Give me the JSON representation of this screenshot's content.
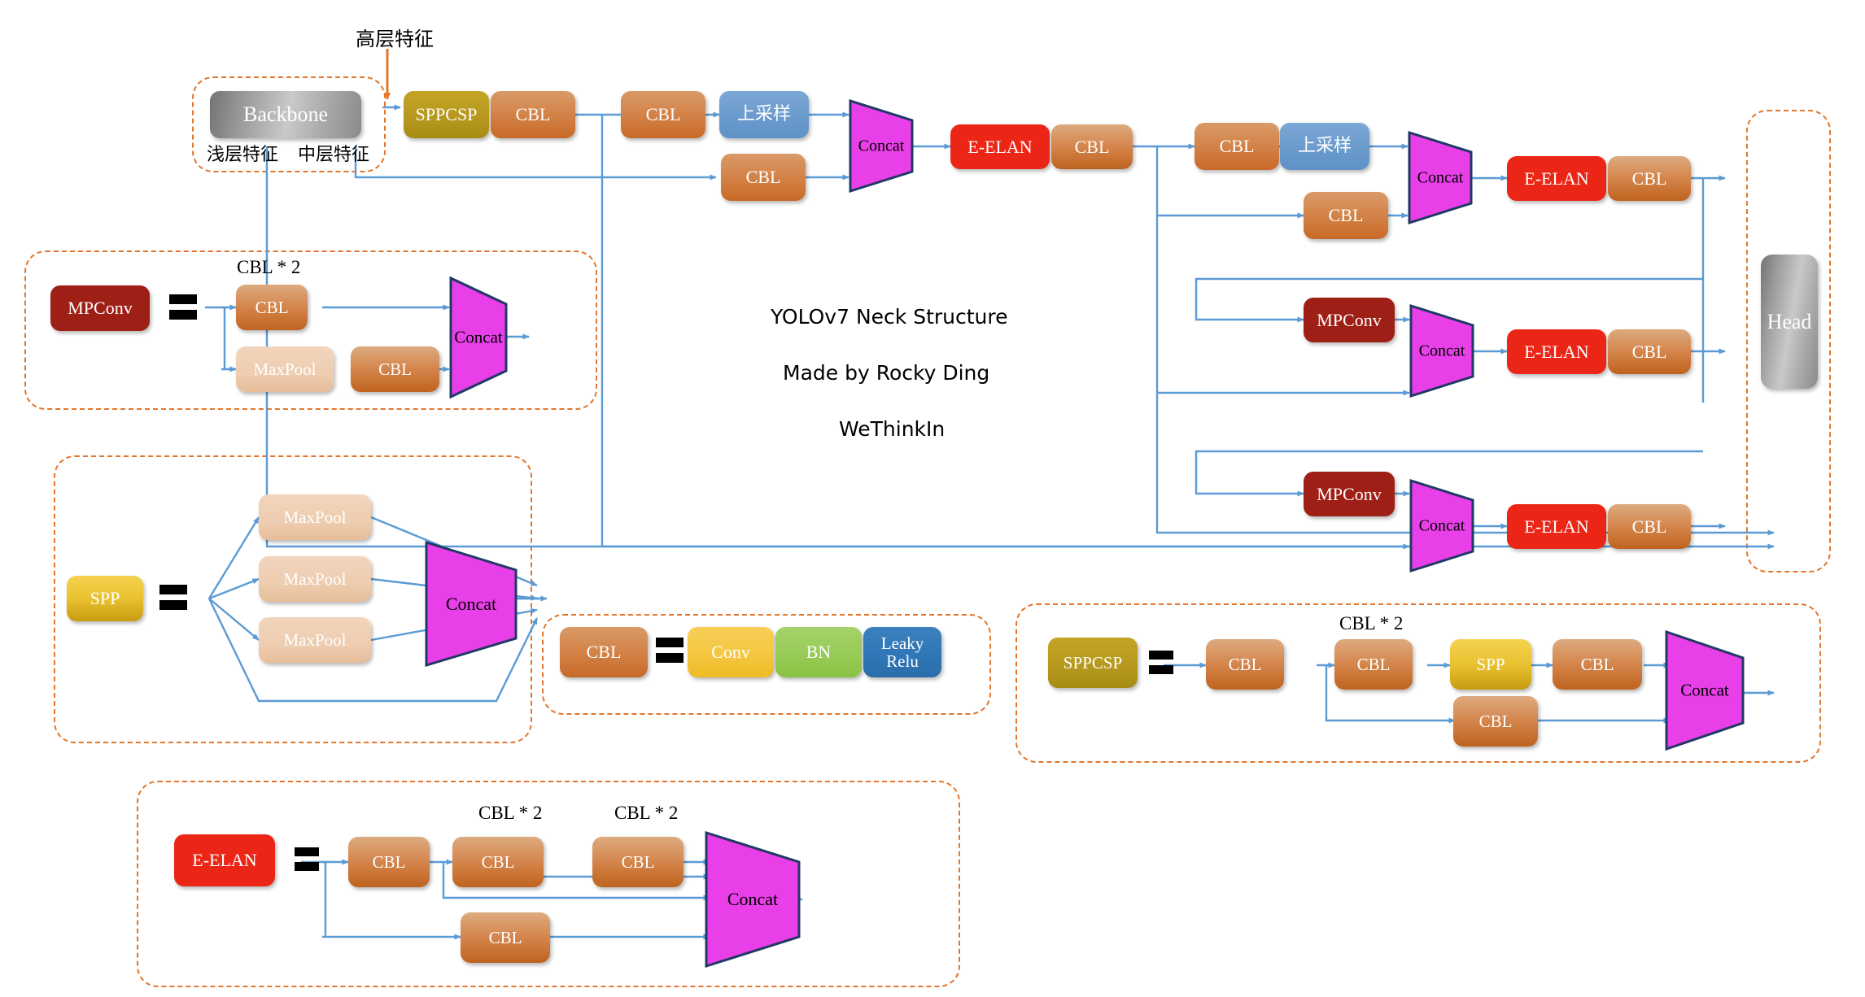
{
  "title": {
    "line1": "YOLOv7 Neck Structure",
    "line2": "Made by Rocky Ding",
    "line3": "WeThinkIn"
  },
  "colors": {
    "accent_dashed": "#e2762c",
    "wire": "#5b9bd5",
    "cbl": "#c86a28",
    "eelan": "#ec2616",
    "mpconv": "#9e1f15",
    "concat": "#e83fe8",
    "sppcsp": "#b89a1f",
    "spp": "#e9c231",
    "upsample": "#6b9bcd",
    "maxpool": "#eecdb0",
    "conv": "#f4c63f",
    "bn": "#96ca55",
    "leakyrelu": "#2f76b6",
    "gray_block": "#9a9a9a"
  },
  "backbone_group": {
    "block_label": "Backbone",
    "caption_shallow": "浅层特征",
    "caption_mid": "中层特征",
    "high_level_label": "高层特征"
  },
  "neck": {
    "row1": {
      "sppcsp": "SPPCSP",
      "cbl_a": "CBL",
      "cbl_b": "CBL",
      "upsample": "上采样",
      "cbl_skip": "CBL",
      "concat": "Concat",
      "eelan": "E-ELAN",
      "cbl_out": "CBL"
    },
    "row2": {
      "cbl_a": "CBL",
      "upsample": "上采样",
      "cbl_skip": "CBL",
      "concat": "Concat",
      "eelan": "E-ELAN",
      "cbl_out": "CBL"
    },
    "row3": {
      "mpconv": "MPConv",
      "concat": "Concat",
      "eelan": "E-ELAN",
      "cbl_out": "CBL"
    },
    "row4": {
      "mpconv": "MPConv",
      "concat": "Concat",
      "eelan": "E-ELAN",
      "cbl_out": "CBL"
    }
  },
  "head_group": {
    "block_label": "Head"
  },
  "legend_mpconv": {
    "lhs": "MPConv",
    "note": "CBL * 2",
    "cbl_top": "CBL",
    "maxpool": "MaxPool",
    "cbl_bottom": "CBL",
    "concat": "Concat"
  },
  "legend_spp": {
    "lhs": "SPP",
    "maxpool_1": "MaxPool",
    "maxpool_2": "MaxPool",
    "maxpool_3": "MaxPool",
    "concat": "Concat"
  },
  "legend_cbl": {
    "lhs": "CBL",
    "conv": "Conv",
    "bn": "BN",
    "leaky_relu_line1": "Leaky",
    "leaky_relu_line2": "Relu"
  },
  "legend_sppcsp": {
    "lhs": "SPPCSP",
    "note": "CBL * 2",
    "cbl_1": "CBL",
    "cbl_2": "CBL",
    "spp": "SPP",
    "cbl_3": "CBL",
    "cbl_skip": "CBL",
    "concat": "Concat"
  },
  "legend_eelan": {
    "lhs": "E-ELAN",
    "note_1": "CBL * 2",
    "note_2": "CBL * 2",
    "cbl_1": "CBL",
    "cbl_2": "CBL",
    "cbl_3": "CBL",
    "cbl_skip": "CBL",
    "concat": "Concat"
  }
}
